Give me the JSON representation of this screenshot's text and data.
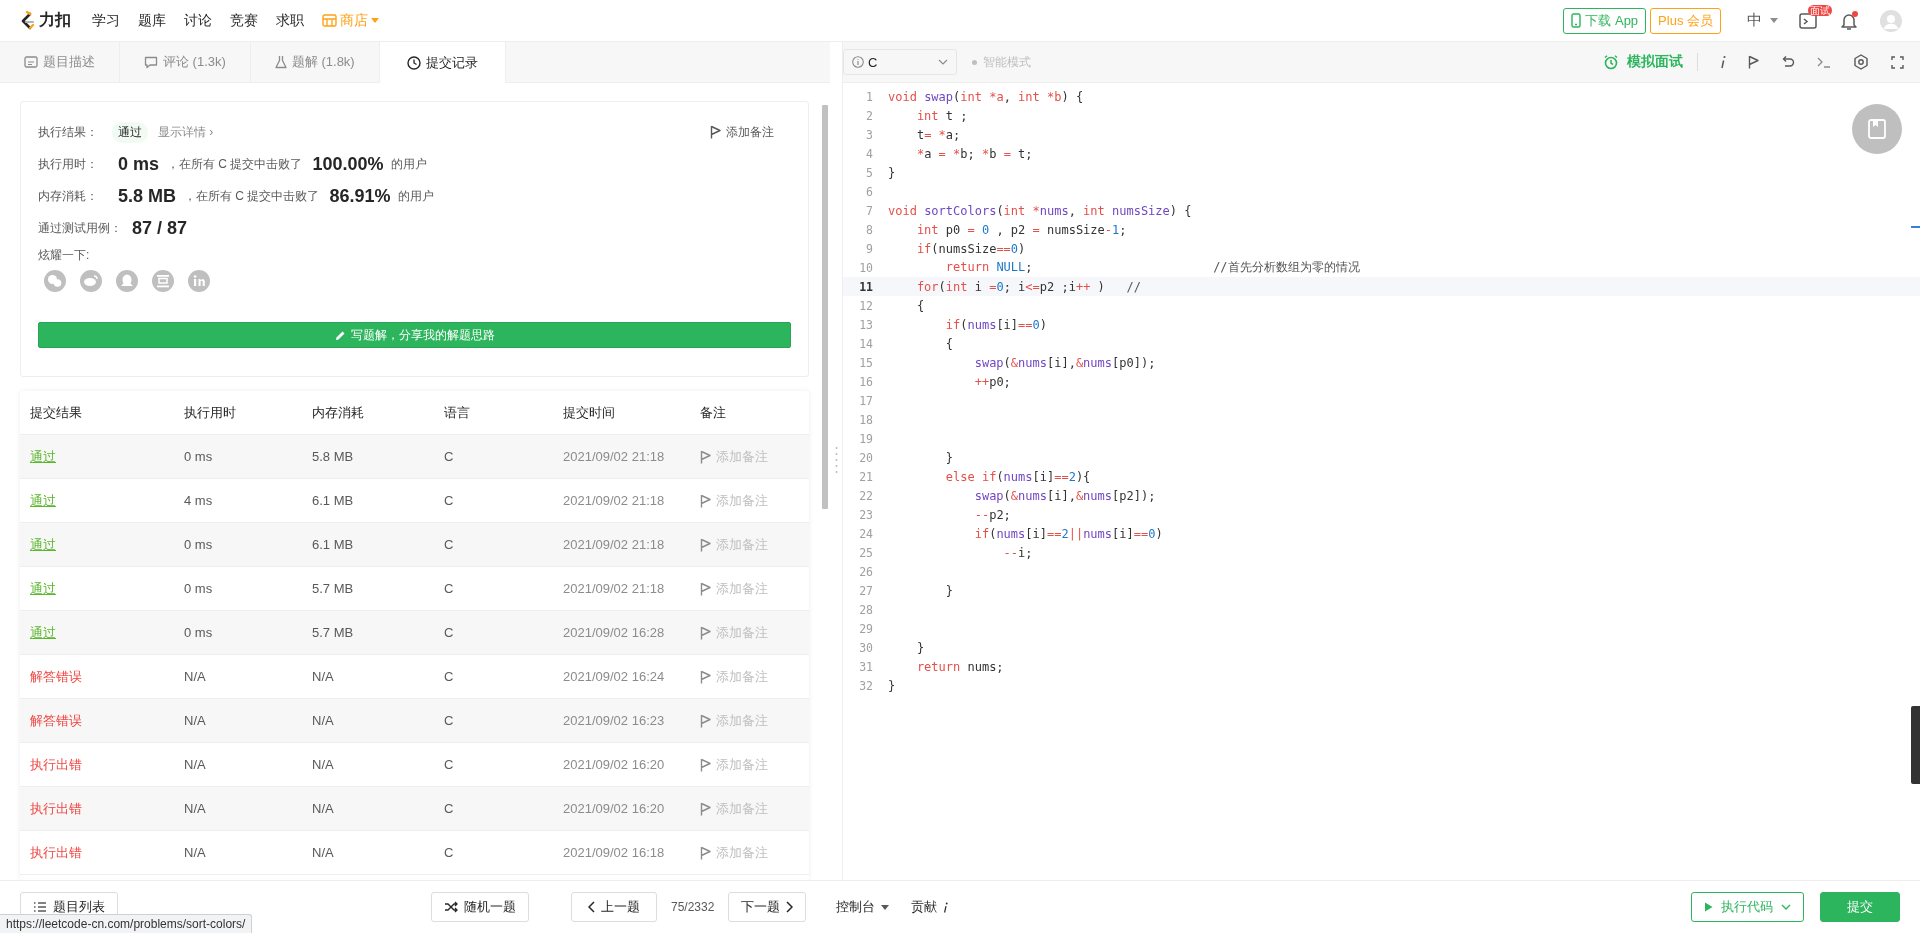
{
  "nav": {
    "logo": "力扣",
    "items": [
      "学习",
      "题库",
      "讨论",
      "竞赛",
      "求职"
    ],
    "store": "商店"
  },
  "account": {
    "download": "下载 App",
    "plus": "Plus 会员",
    "language": "中",
    "interview_badge": "面试",
    "unread": true
  },
  "tabs": [
    {
      "label": "题目描述",
      "kind": "description",
      "selected": false
    },
    {
      "label": "评论 (1.3k)",
      "kind": "comments",
      "selected": false
    },
    {
      "label": "题解 (1.8k)",
      "kind": "solutions",
      "selected": false
    },
    {
      "label": "提交记录",
      "kind": "submissions",
      "selected": true
    }
  ],
  "result": {
    "status_label": "执行结果：",
    "status": "通过",
    "details_link": "显示详情 ›",
    "add_note": "添加备注",
    "runtime_label": "执行用时：",
    "runtime": "0 ms",
    "runtime_text": "，在所有 C 提交中击败了",
    "runtime_percent": "100.00%",
    "runtime_suffix": "的用户",
    "memory_label": "内存消耗：",
    "memory": "5.8 MB",
    "memory_text": "，在所有 C 提交中击败了",
    "memory_percent": "86.91%",
    "memory_suffix": "的用户",
    "tests_label": "通过测试用例：",
    "tests": "87 / 87",
    "share_label": "炫耀一下:",
    "share": [
      {
        "kind": "wechat"
      },
      {
        "kind": "weibo"
      },
      {
        "kind": "qq"
      },
      {
        "kind": "douban"
      },
      {
        "kind": "linkedin"
      }
    ],
    "write_button": "写题解，分享我的解题思路"
  },
  "submissions": {
    "columns": [
      "提交结果",
      "执行用时",
      "内存消耗",
      "语言",
      "提交时间",
      "备注"
    ],
    "rows": [
      {
        "status": "通过",
        "kind": "accepted",
        "runtime": "0 ms",
        "memory": "5.8 MB",
        "language": "C",
        "time": "2021/09/02 21:18",
        "note": "添加备注"
      },
      {
        "status": "通过",
        "kind": "accepted",
        "runtime": "4 ms",
        "memory": "6.1 MB",
        "language": "C",
        "time": "2021/09/02 21:18",
        "note": "添加备注"
      },
      {
        "status": "通过",
        "kind": "accepted",
        "runtime": "0 ms",
        "memory": "6.1 MB",
        "language": "C",
        "time": "2021/09/02 21:18",
        "note": "添加备注"
      },
      {
        "status": "通过",
        "kind": "accepted",
        "runtime": "0 ms",
        "memory": "5.7 MB",
        "language": "C",
        "time": "2021/09/02 21:18",
        "note": "添加备注"
      },
      {
        "status": "通过",
        "kind": "accepted",
        "runtime": "0 ms",
        "memory": "5.7 MB",
        "language": "C",
        "time": "2021/09/02 16:28",
        "note": "添加备注"
      },
      {
        "status": "解答错误",
        "kind": "error",
        "runtime": "N/A",
        "memory": "N/A",
        "language": "C",
        "time": "2021/09/02 16:24",
        "note": "添加备注"
      },
      {
        "status": "解答错误",
        "kind": "error",
        "runtime": "N/A",
        "memory": "N/A",
        "language": "C",
        "time": "2021/09/02 16:23",
        "note": "添加备注"
      },
      {
        "status": "执行出错",
        "kind": "error",
        "runtime": "N/A",
        "memory": "N/A",
        "language": "C",
        "time": "2021/09/02 16:20",
        "note": "添加备注"
      },
      {
        "status": "执行出错",
        "kind": "error",
        "runtime": "N/A",
        "memory": "N/A",
        "language": "C",
        "time": "2021/09/02 16:20",
        "note": "添加备注"
      },
      {
        "status": "执行出错",
        "kind": "error",
        "runtime": "N/A",
        "memory": "N/A",
        "language": "C",
        "time": "2021/09/02 16:18",
        "note": "添加备注"
      }
    ]
  },
  "editor": {
    "language": "C",
    "mode": "智能模式",
    "interview": "模拟面试",
    "lines": [
      {
        "number": "1",
        "current": false,
        "tokens": [
          {
            "kind": "kw",
            "text": "void "
          },
          {
            "kind": "fn",
            "text": "swap"
          },
          {
            "kind": "p",
            "text": "("
          },
          {
            "kind": "kw",
            "text": "int "
          },
          {
            "kind": "kw",
            "text": "*a"
          },
          {
            "kind": "p",
            "text": ", "
          },
          {
            "kind": "kw",
            "text": "int "
          },
          {
            "kind": "kw",
            "text": "*b"
          },
          {
            "kind": "p",
            "text": ") {"
          }
        ]
      },
      {
        "number": "2",
        "current": false,
        "tokens": [
          {
            "kind": "kw",
            "text": "    int"
          },
          {
            "kind": "p",
            "text": " t ;"
          }
        ]
      },
      {
        "number": "3",
        "current": false,
        "tokens": [
          {
            "kind": "p",
            "text": "    t"
          },
          {
            "kind": "kw",
            "text": "= *"
          },
          {
            "kind": "p",
            "text": "a;"
          }
        ]
      },
      {
        "number": "4",
        "current": false,
        "tokens": [
          {
            "kind": "kw",
            "text": "    *"
          },
          {
            "kind": "p",
            "text": "a "
          },
          {
            "kind": "kw",
            "text": "= *"
          },
          {
            "kind": "p",
            "text": "b; "
          },
          {
            "kind": "kw",
            "text": "*"
          },
          {
            "kind": "p",
            "text": "b "
          },
          {
            "kind": "kw",
            "text": "="
          },
          {
            "kind": "p",
            "text": " t;"
          }
        ]
      },
      {
        "number": "5",
        "current": false,
        "tokens": [
          {
            "kind": "p",
            "text": "}"
          }
        ]
      },
      {
        "number": "6",
        "current": false
      },
      {
        "number": "7",
        "current": false,
        "tokens": [
          {
            "kind": "kw",
            "text": "void "
          },
          {
            "kind": "fn",
            "text": "sortColors"
          },
          {
            "kind": "p",
            "text": "("
          },
          {
            "kind": "kw",
            "text": "int *"
          },
          {
            "kind": "fn",
            "text": "nums"
          },
          {
            "kind": "p",
            "text": ", "
          },
          {
            "kind": "kw",
            "text": "int "
          },
          {
            "kind": "fn",
            "text": "numsSize"
          },
          {
            "kind": "p",
            "text": ") {"
          }
        ]
      },
      {
        "number": "8",
        "current": false,
        "tokens": [
          {
            "kind": "kw",
            "text": "    int"
          },
          {
            "kind": "p",
            "text": " p0 "
          },
          {
            "kind": "kw",
            "text": "= "
          },
          {
            "kind": "num",
            "text": "0"
          },
          {
            "kind": "p",
            "text": " , p2 "
          },
          {
            "kind": "kw",
            "text": "="
          },
          {
            "kind": "p",
            "text": " numsSize"
          },
          {
            "kind": "kw",
            "text": "-"
          },
          {
            "kind": "num",
            "text": "1"
          },
          {
            "kind": "p",
            "text": ";"
          }
        ]
      },
      {
        "number": "9",
        "current": false,
        "tokens": [
          {
            "kind": "kw",
            "text": "    if"
          },
          {
            "kind": "p",
            "text": "(numsSize"
          },
          {
            "kind": "kw",
            "text": "=="
          },
          {
            "kind": "num",
            "text": "0"
          },
          {
            "kind": "p",
            "text": ")"
          }
        ]
      },
      {
        "number": "10",
        "current": false,
        "tokens": [
          {
            "kind": "kw",
            "text": "        return "
          },
          {
            "kind": "num",
            "text": "NULL"
          },
          {
            "kind": "p",
            "text": ";                         "
          },
          {
            "kind": "cm",
            "text": "//首先分析数组为零的情况"
          }
        ]
      },
      {
        "number": "11",
        "current": true,
        "tokens": [
          {
            "kind": "kw",
            "text": "    for"
          },
          {
            "kind": "p",
            "text": "("
          },
          {
            "kind": "kw",
            "text": "int"
          },
          {
            "kind": "p",
            "text": " i "
          },
          {
            "kind": "kw",
            "text": "="
          },
          {
            "kind": "num",
            "text": "0"
          },
          {
            "kind": "p",
            "text": "; i"
          },
          {
            "kind": "kw",
            "text": "<="
          },
          {
            "kind": "p",
            "text": "p2 ;i"
          },
          {
            "kind": "kw",
            "text": "++"
          },
          {
            "kind": "p",
            "text": " )   "
          },
          {
            "kind": "cm",
            "text": "//"
          }
        ]
      },
      {
        "number": "12",
        "current": false,
        "tokens": [
          {
            "kind": "p",
            "text": "    {"
          }
        ]
      },
      {
        "number": "13",
        "current": false,
        "tokens": [
          {
            "kind": "kw",
            "text": "        if"
          },
          {
            "kind": "p",
            "text": "("
          },
          {
            "kind": "fn",
            "text": "nums"
          },
          {
            "kind": "p",
            "text": "[i]"
          },
          {
            "kind": "kw",
            "text": "=="
          },
          {
            "kind": "num",
            "text": "0"
          },
          {
            "kind": "p",
            "text": ")"
          }
        ]
      },
      {
        "number": "14",
        "current": false,
        "tokens": [
          {
            "kind": "p",
            "text": "        {"
          }
        ]
      },
      {
        "number": "15",
        "current": false,
        "tokens": [
          {
            "kind": "fn",
            "text": "            swap"
          },
          {
            "kind": "p",
            "text": "("
          },
          {
            "kind": "kw",
            "text": "&"
          },
          {
            "kind": "fn",
            "text": "nums"
          },
          {
            "kind": "p",
            "text": "[i],"
          },
          {
            "kind": "kw",
            "text": "&"
          },
          {
            "kind": "fn",
            "text": "nums"
          },
          {
            "kind": "p",
            "text": "[p0]);"
          }
        ]
      },
      {
        "number": "16",
        "current": false,
        "tokens": [
          {
            "kind": "kw",
            "text": "            ++"
          },
          {
            "kind": "p",
            "text": "p0;"
          }
        ]
      },
      {
        "number": "17",
        "current": false
      },
      {
        "number": "18",
        "current": false
      },
      {
        "number": "19",
        "current": false
      },
      {
        "number": "20",
        "current": false,
        "tokens": [
          {
            "kind": "p",
            "text": "        }"
          }
        ]
      },
      {
        "number": "21",
        "current": false,
        "tokens": [
          {
            "kind": "kw",
            "text": "        else if"
          },
          {
            "kind": "p",
            "text": "("
          },
          {
            "kind": "fn",
            "text": "nums"
          },
          {
            "kind": "p",
            "text": "[i]"
          },
          {
            "kind": "kw",
            "text": "=="
          },
          {
            "kind": "num",
            "text": "2"
          },
          {
            "kind": "p",
            "text": "){"
          }
        ]
      },
      {
        "number": "22",
        "current": false,
        "tokens": [
          {
            "kind": "fn",
            "text": "            swap"
          },
          {
            "kind": "p",
            "text": "("
          },
          {
            "kind": "kw",
            "text": "&"
          },
          {
            "kind": "fn",
            "text": "nums"
          },
          {
            "kind": "p",
            "text": "[i],"
          },
          {
            "kind": "kw",
            "text": "&"
          },
          {
            "kind": "fn",
            "text": "nums"
          },
          {
            "kind": "p",
            "text": "[p2]);"
          }
        ]
      },
      {
        "number": "23",
        "current": false,
        "tokens": [
          {
            "kind": "kw",
            "text": "            --"
          },
          {
            "kind": "p",
            "text": "p2;"
          }
        ]
      },
      {
        "number": "24",
        "current": false,
        "tokens": [
          {
            "kind": "kw",
            "text": "            if"
          },
          {
            "kind": "p",
            "text": "("
          },
          {
            "kind": "fn",
            "text": "nums"
          },
          {
            "kind": "p",
            "text": "[i]"
          },
          {
            "kind": "kw",
            "text": "=="
          },
          {
            "kind": "num",
            "text": "2"
          },
          {
            "kind": "kw",
            "text": "||"
          },
          {
            "kind": "fn",
            "text": "nums"
          },
          {
            "kind": "p",
            "text": "[i]"
          },
          {
            "kind": "kw",
            "text": "=="
          },
          {
            "kind": "num",
            "text": "0"
          },
          {
            "kind": "p",
            "text": ")"
          }
        ]
      },
      {
        "number": "25",
        "current": false,
        "tokens": [
          {
            "kind": "kw",
            "text": "                --"
          },
          {
            "kind": "p",
            "text": "i;"
          }
        ]
      },
      {
        "number": "26",
        "current": false
      },
      {
        "number": "27",
        "current": false,
        "tokens": [
          {
            "kind": "p",
            "text": "        }"
          }
        ]
      },
      {
        "number": "28",
        "current": false
      },
      {
        "number": "29",
        "current": false
      },
      {
        "number": "30",
        "current": false,
        "tokens": [
          {
            "kind": "p",
            "text": "    }"
          }
        ]
      },
      {
        "number": "31",
        "current": false,
        "tokens": [
          {
            "kind": "kw",
            "text": "    return"
          },
          {
            "kind": "p",
            "text": " nums;"
          }
        ]
      },
      {
        "number": "32",
        "current": false,
        "tokens": [
          {
            "kind": "p",
            "text": "}"
          }
        ]
      }
    ]
  },
  "bottom": {
    "problem_list": "题目列表",
    "random": "随机一题",
    "prev": "上一题",
    "position": "75/2332",
    "next": "下一题",
    "console": "控制台",
    "contribute": "贡献",
    "run": "执行代码",
    "submit": "提交"
  },
  "status_url": "https://leetcode-cn.com/problems/sort-colors/"
}
